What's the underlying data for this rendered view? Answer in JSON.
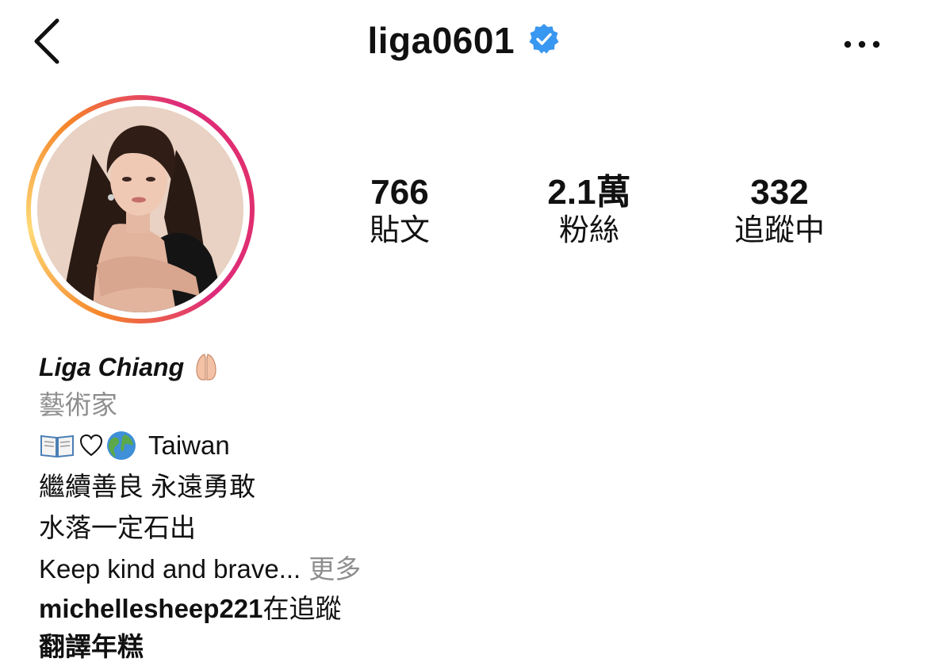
{
  "header": {
    "back_icon": "chevron-left-icon",
    "username": "liga0601",
    "verified_icon": "verified-badge-icon",
    "more_icon": "ellipsis-icon"
  },
  "profile": {
    "avatar_icon": "profile-photo",
    "stats": [
      {
        "value": "766",
        "label": "貼文"
      },
      {
        "value": "2.1萬",
        "label": "粉絲"
      },
      {
        "value": "332",
        "label": "追蹤中"
      }
    ],
    "display_name": "Liga Chiang",
    "category": "藝術家",
    "bio_location": "Taiwan",
    "bio_line2": "繼續善良 永遠勇敢",
    "bio_line3": "水落一定石出",
    "bio_line4": "Keep kind and brave...",
    "more_label": "更多",
    "followed_by_user": "michellesheep221",
    "followed_by_suffix": "在追蹤",
    "translate_label": "翻譯年糕"
  },
  "colors": {
    "verified": "#3897f0",
    "muted": "#8e8e8e",
    "ring_start": "#f58529",
    "ring_end": "#dd2a7b"
  }
}
